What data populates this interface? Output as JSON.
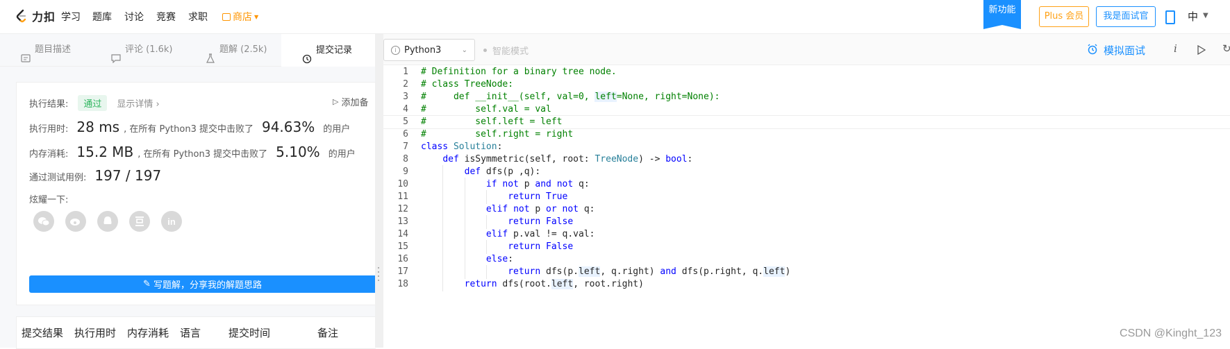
{
  "nav": {
    "logo_text": "力扣",
    "links": [
      "学习",
      "题库",
      "讨论",
      "竞赛",
      "求职"
    ],
    "shop_label": "商店",
    "new_feature": "新功能",
    "plus_label": "Plus 会员",
    "interviewer_label": "我是面试官",
    "language": "中"
  },
  "left_tabs": [
    {
      "label": "题目描述",
      "icon": "description-icon"
    },
    {
      "label": "评论 (1.6k)",
      "icon": "comment-icon"
    },
    {
      "label": "题解 (2.5k)",
      "icon": "flask-icon"
    },
    {
      "label": "提交记录",
      "icon": "clock-icon"
    }
  ],
  "result": {
    "label": "执行结果:",
    "status": "通过",
    "details_link": "显示详情 ›",
    "add_note": "添加备",
    "runtime_label": "执行用时:",
    "runtime_value": "28 ms",
    "runtime_text": ", 在所有 Python3 提交中击败了",
    "runtime_pct": "94.63%",
    "users": "的用户",
    "memory_label": "内存消耗:",
    "memory_value": "15.2 MB",
    "memory_text": ", 在所有 Python3 提交中击败了",
    "memory_pct": "5.10%",
    "tests_label": "通过测试用例:",
    "tests_value": "197 / 197",
    "share_label": "炫耀一下:",
    "share_icons": [
      "wechat-icon",
      "weibo-icon",
      "qq-icon",
      "douban-icon",
      "linkedin-icon"
    ],
    "write_button": "写题解，分享我的解题思路"
  },
  "table_headers": [
    "提交结果",
    "执行用时",
    "内存消耗",
    "语言",
    "提交时间",
    "备注"
  ],
  "editor": {
    "language": "Python3",
    "smart_mode": "智能模式",
    "mock_interview": "模拟面试",
    "info_icon": "i"
  },
  "code_lines": [
    "# Definition for a binary tree node.",
    "# class TreeNode:",
    "#     def __init__(self, val=0, left=None, right=None):",
    "#         self.val = val",
    "#         self.left = left",
    "#         self.right = right",
    "class Solution:",
    "    def isSymmetric(self, root: TreeNode) -> bool:",
    "        def dfs(p ,q):",
    "            if not p and not q:",
    "                return True",
    "            elif not p or not q:",
    "                return False",
    "            elif p.val != q.val:",
    "                return False",
    "            else:",
    "                return dfs(p.left, q.right) and dfs(p.right, q.left)",
    "        return dfs(root.left, root.right)"
  ],
  "watermark": "CSDN @Kinght_123"
}
